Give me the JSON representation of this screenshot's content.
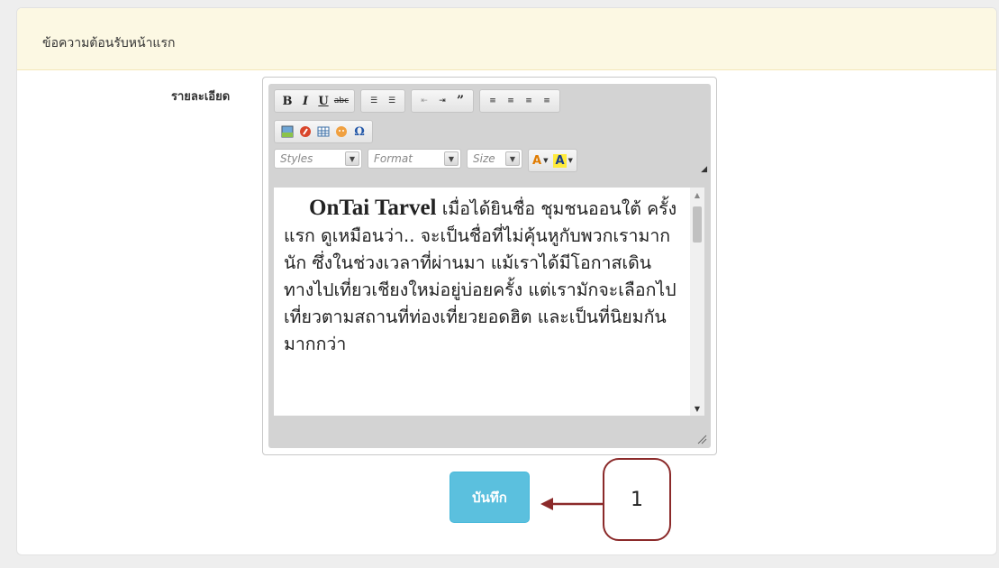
{
  "panel": {
    "title": "ข้อความต้อนรับหน้าแรก"
  },
  "form": {
    "label": "รายละเอียด",
    "save_label": "บันทึก"
  },
  "editor": {
    "toolbar": {
      "bold": "B",
      "italic": "I",
      "underline": "U",
      "strike": "abc",
      "styles": "Styles",
      "format": "Format",
      "size": "Size",
      "text_color": "A",
      "bg_color": "A",
      "special_char": "Ω"
    },
    "content": {
      "lead": "OnTai Tarvel",
      "body": " เมื่อได้ยินชื่อ ชุมชนออนใต้ ครั้งแรก ดูเหมือนว่า.. จะเป็นชื่อที่ไม่คุ้นหูกับพวกเรามากนัก ซึ่งในช่วงเวลาที่ผ่านมา แม้เราได้มีโอกาสเดินทางไปเที่ยวเชียงใหม่อยู่บ่อยครั้ง แต่เรามักจะเลือกไปเที่ยวตามสถานที่ท่องเที่ยวยอดฮิต และเป็นที่นิยมกันมากกว่า"
    }
  },
  "annotation": {
    "number": "1"
  },
  "colors": {
    "accent": "#5bc0de",
    "callout": "#8b2a2a",
    "header_bg": "#fcf8e3"
  }
}
